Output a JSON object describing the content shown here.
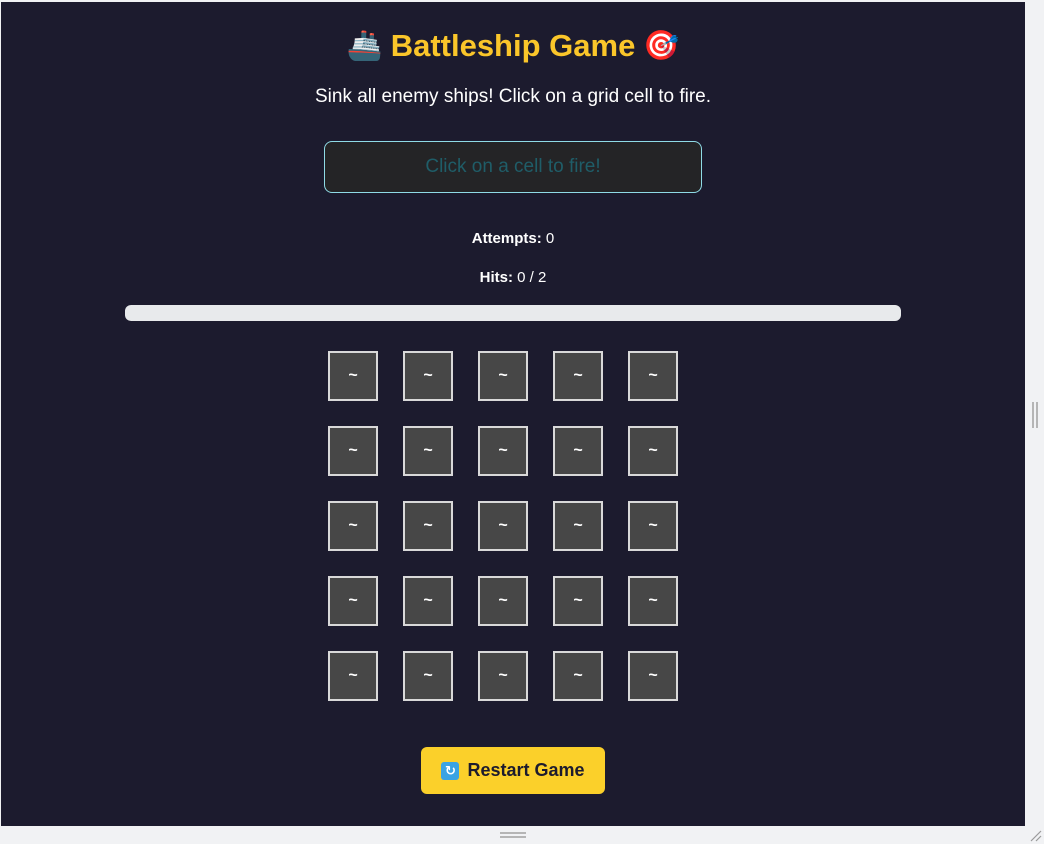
{
  "header": {
    "ship_emoji": "🚢",
    "title": "Battleship Game",
    "target_emoji": "🎯",
    "subtitle": "Sink all enemy ships! Click on a grid cell to fire."
  },
  "message": {
    "text": "Click on a cell to fire!"
  },
  "stats": {
    "attempts_label": "Attempts:",
    "attempts_value": "0",
    "hits_label": "Hits:",
    "hits_value": "0 / 2"
  },
  "progress": {
    "fraction": 0
  },
  "grid": {
    "rows": 5,
    "cols": 5,
    "cells": [
      [
        "~",
        "~",
        "~",
        "~",
        "~"
      ],
      [
        "~",
        "~",
        "~",
        "~",
        "~"
      ],
      [
        "~",
        "~",
        "~",
        "~",
        "~"
      ],
      [
        "~",
        "~",
        "~",
        "~",
        "~"
      ],
      [
        "~",
        "~",
        "~",
        "~",
        "~"
      ]
    ]
  },
  "restart_button": {
    "icon": "refresh-icon",
    "label": "Restart Game"
  },
  "colors": {
    "background": "#1c1b2e",
    "title": "#fac62a",
    "button": "#fbd02a",
    "cell": "#474747"
  }
}
